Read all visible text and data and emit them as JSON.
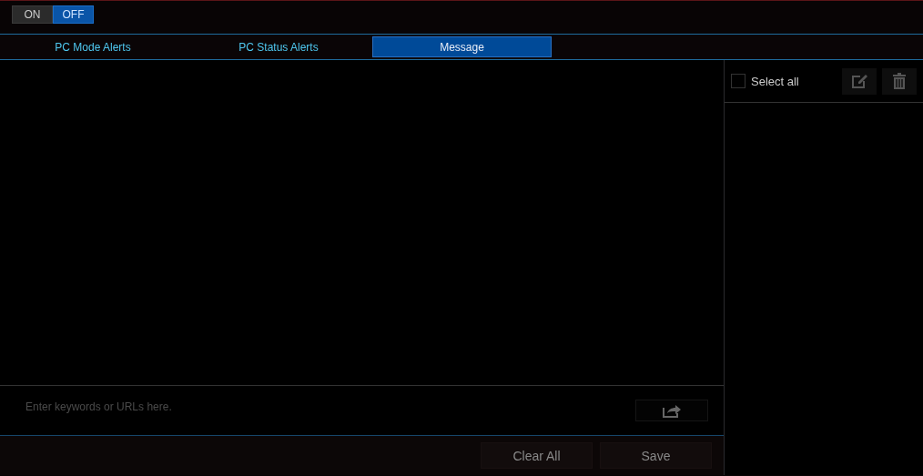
{
  "power_toggle": {
    "options": [
      {
        "label": "ON",
        "selected": false
      },
      {
        "label": "OFF",
        "selected": true
      }
    ]
  },
  "tabs": [
    {
      "label": "PC Mode Alerts",
      "selected": false
    },
    {
      "label": "PC Status Alerts",
      "selected": false
    },
    {
      "label": "Message",
      "selected": true
    }
  ],
  "message_input": {
    "placeholder": "Enter keywords or URLs here."
  },
  "buttons": [
    {
      "label": "Clear All"
    },
    {
      "label": "Save"
    }
  ],
  "side_panel": {
    "select_all": {
      "label": "Select all",
      "checked": false
    }
  }
}
